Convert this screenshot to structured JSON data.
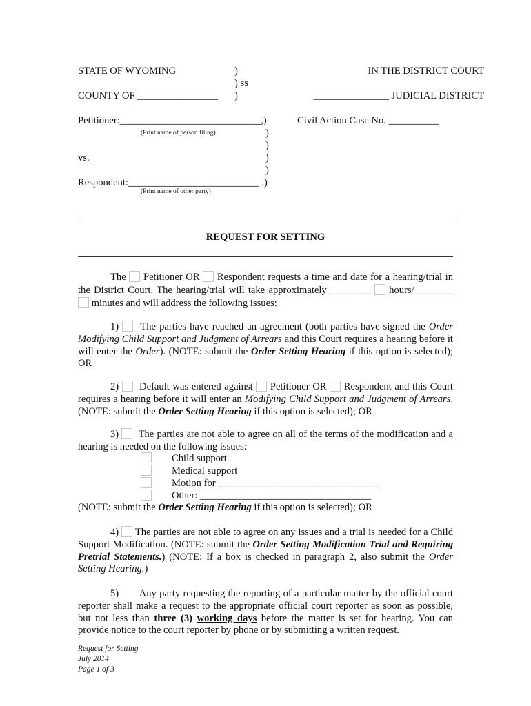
{
  "caption": {
    "state": "STATE OF WYOMING",
    "paren": ")",
    "paren_ss": ") ss",
    "court": "IN THE DISTRICT COURT",
    "county": "COUNTY OF ________________",
    "district": "_______________ JUDICIAL DISTRICT",
    "petitioner": "Petitioner:____________________________,)",
    "petitioner_hint": "(Print name of person filing)",
    "case_no": "Civil Action Case No. __________",
    "vs": "vs.",
    "respondent": "Respondent:__________________________ .)",
    "respondent_hint": "(Print name of other party)"
  },
  "title": "REQUEST FOR SETTING",
  "intro": {
    "t1": "The",
    "t2": "Petitioner OR",
    "t3": "Respondent requests a time and date for a hearing/trial in the District Court. The hearing/trial will take approximately ________",
    "t4": "hours/ _______",
    "t5": "minutes and will address the following issues:"
  },
  "item1": {
    "num": "1)",
    "a": "The parties have reached an agreement (both parties have signed the ",
    "b": "Order Modifying Child Support and Judgment of Arrears",
    "c": " and this Court requires a hearing before it will enter the ",
    "d": "Order",
    "e": "). (NOTE:  submit the ",
    "f": "Order Setting Hearing",
    "g": " if this option is selected); OR"
  },
  "item2": {
    "num": "2)",
    "a": "Default was entered against",
    "b": "Petitioner OR",
    "c": "Respondent and this Court requires a hearing before it will enter an ",
    "d": "Modifying Child Support and Judgment of Arrears",
    "e": ".   (NOTE: submit the ",
    "f": "Order Setting Hearing",
    "g": " if this option is selected); OR"
  },
  "item3": {
    "num": "3)",
    "a": "The parties are not able to agree on all of the terms of the modification and a hearing is needed on the following issues:",
    "issues": [
      "Child support",
      "Medical support",
      "Motion for ________________________________",
      "Other: __________________________________"
    ],
    "note_a": "(NOTE:  submit the ",
    "note_b": "Order Setting Hearing",
    "note_c": " if this option is selected); OR"
  },
  "item4": {
    "num": "4)",
    "a": "The parties are not able to agree on any issues and a trial is needed for a Child Support Modification. (NOTE: submit the ",
    "b": "Order Setting Modification Trial and Requiring Pretrial Statements.",
    "c": ") (NOTE:  If a box is checked in paragraph 2, also submit the ",
    "d": "Order Setting Hearing.",
    "e": ")"
  },
  "item5": {
    "num": "5)",
    "a": "Any party requesting the reporting of a particular matter by the official court reporter shall make a request to the appropriate official court reporter as soon as possible, but not less than ",
    "b": "three (3) ",
    "c": "working days",
    "d": " before the matter is set for hearing. You can provide notice to the court reporter by phone or by submitting a written request."
  },
  "footer": {
    "line1": "Request for Setting",
    "line2": "July 2014",
    "line3": "Page 1 of 3"
  }
}
